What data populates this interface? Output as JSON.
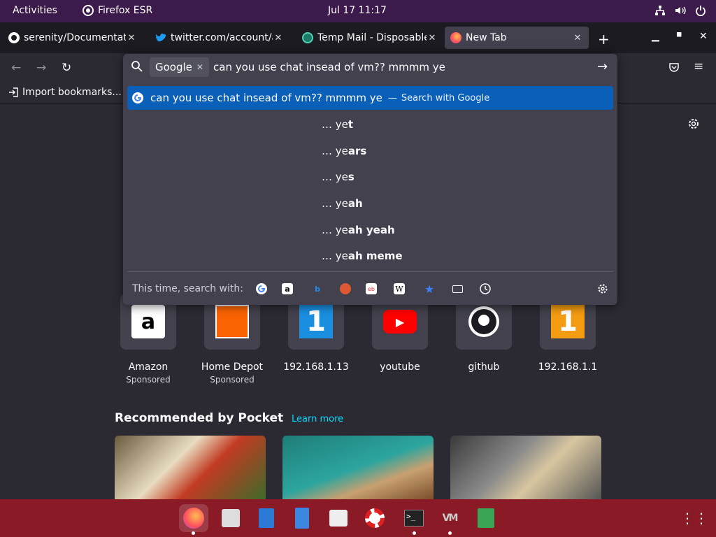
{
  "topbar": {
    "activities": "Activities",
    "app_name": "Firefox ESR",
    "clock": "Jul 17  11:17",
    "icons": [
      "network-icon",
      "volume-icon",
      "power-icon"
    ]
  },
  "tabs": [
    {
      "title": "serenity/Documentation",
      "icon": "github-icon"
    },
    {
      "title": "twitter.com/account/access",
      "icon": "twitter-icon"
    },
    {
      "title": "Temp Mail - Disposable",
      "icon": "tempmail-icon"
    },
    {
      "title": "New Tab",
      "icon": "firefox-icon",
      "active": true
    }
  ],
  "bookmarks_bar": {
    "import_label": "Import bookmarks..."
  },
  "urlbar": {
    "engine_chip": "Google",
    "query": "can you use chat insead of vm?? mmmm ye",
    "top_result": {
      "text": "can you use chat insead of vm?? mmmm ye",
      "separator": "—",
      "action": "Search with Google"
    },
    "suggestions": [
      {
        "prefix": "… ye",
        "completion": "t"
      },
      {
        "prefix": "… ye",
        "completion": "ars"
      },
      {
        "prefix": "… ye",
        "completion": "s"
      },
      {
        "prefix": "… ye",
        "completion": "ah"
      },
      {
        "prefix": "… ye",
        "completion": "ah yeah"
      },
      {
        "prefix": "… ye",
        "completion": "ah meme"
      }
    ],
    "oneoff_label": "This time, search with:",
    "oneoff_engines": [
      "Google",
      "Amazon",
      "Bing",
      "DuckDuckGo",
      "eBay",
      "Wikipedia",
      "Bookmarks",
      "Tabs",
      "History"
    ]
  },
  "top_sites": [
    {
      "name": "Amazon",
      "sponsored": "Sponsored"
    },
    {
      "name": "Home Depot",
      "sponsored": "Sponsored"
    },
    {
      "name": "192.168.1.13",
      "sponsored": ""
    },
    {
      "name": "youtube",
      "sponsored": ""
    },
    {
      "name": "github",
      "sponsored": ""
    },
    {
      "name": "192.168.1.1",
      "sponsored": ""
    }
  ],
  "pocket": {
    "title": "Recommended by Pocket",
    "learn_more": "Learn more"
  },
  "colors": {
    "topbar": "#3c1a4c",
    "dock": "#8a1a26",
    "highlight": "#0a60b8",
    "content_bg": "#2b2a33"
  }
}
